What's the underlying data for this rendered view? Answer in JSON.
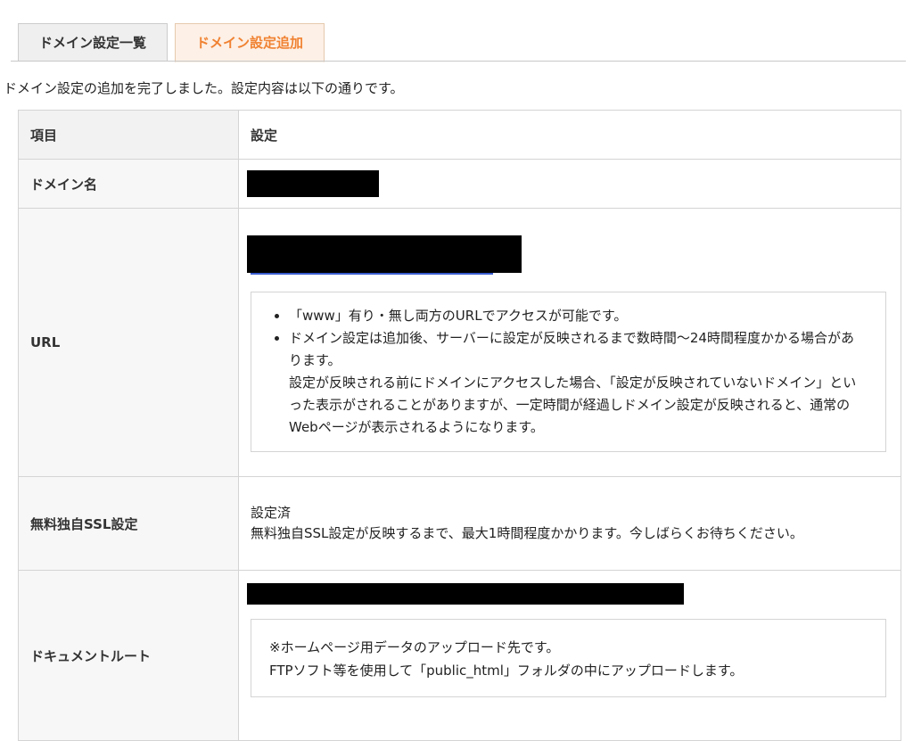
{
  "tabs": {
    "list_label": "ドメイン設定一覧",
    "add_label": "ドメイン設定追加",
    "active": "add"
  },
  "message": "ドメイン設定の追加を完了しました。設定内容は以下の通りです。",
  "table": {
    "header": {
      "item": "項目",
      "setting": "設定"
    },
    "rows": {
      "domain": {
        "label": "ドメイン名"
      },
      "url": {
        "label": "URL",
        "notes": [
          "「www」有り・無し両方のURLでアクセスが可能です。",
          "ドメイン設定は追加後、サーバーに設定が反映されるまで数時間〜24時間程度かかる場合があります。"
        ],
        "note_extra": "設定が反映される前にドメインにアクセスした場合、「設定が反映されていないドメイン」といった表示がされることがありますが、一定時間が経過しドメイン設定が反映されると、通常のWebページが表示されるようになります。"
      },
      "ssl": {
        "label": "無料独自SSL設定",
        "status": "設定済",
        "note": "無料独自SSL設定が反映するまで、最大1時間程度かかります。今しばらくお待ちください。"
      },
      "docroot": {
        "label": "ドキュメントルート",
        "note_line1": "※ホームページ用データのアップロード先です。",
        "note_line2": "FTPソフト等を使用して「public_html」フォルダの中にアップロードします。"
      }
    }
  },
  "colors": {
    "active_tab_text": "#f08232",
    "active_tab_bg": "#fdf0e6",
    "link": "#3a5dcf"
  }
}
